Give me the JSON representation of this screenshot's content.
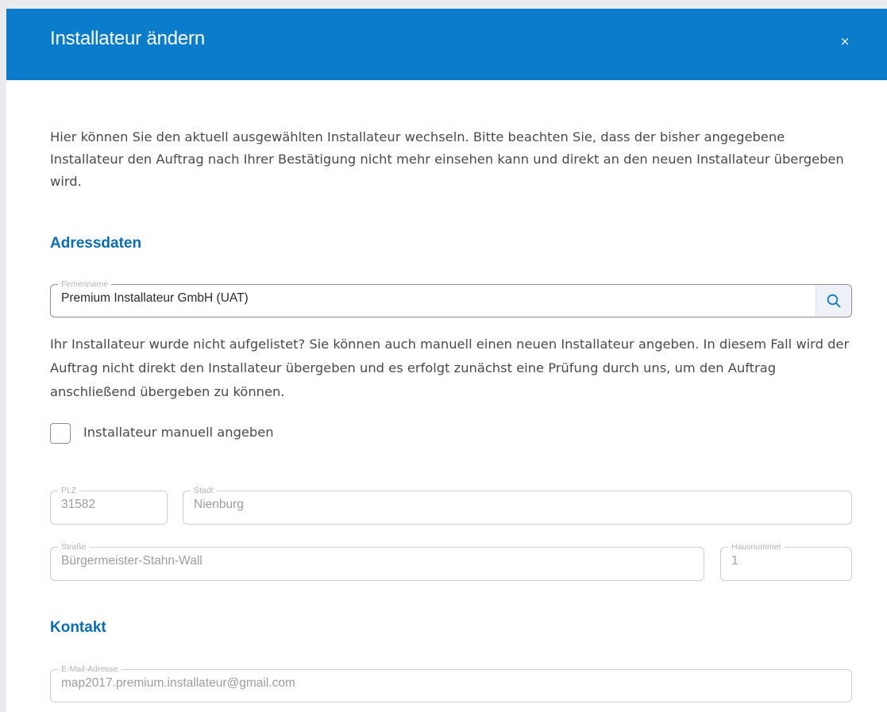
{
  "dialog": {
    "title": "Installateur ändern",
    "close_label": "×",
    "intro": "Hier können Sie den aktuell ausgewählten Installateur wechseln. Bitte beachten Sie, dass der bisher angegebene Installateur den Auftrag nach Ihrer Bestätigung nicht mehr einsehen kann und direkt an den neuen Installateur übergeben wird."
  },
  "address": {
    "heading": "Adressdaten",
    "company": {
      "label": "Firmenname",
      "value": "Premium Installateur GmbH (UAT)",
      "search_icon": "search-icon"
    },
    "note": "Ihr Installateur wurde nicht aufgelistet? Sie können auch manuell einen neuen Installateur angeben. In diesem Fall wird der Auftrag nicht direkt den Installateur übergeben und es erfolgt zunächst eine Prüfung durch uns, um den Auftrag anschließend übergeben zu können.",
    "manual_checkbox": {
      "label": "Installateur manuell angeben",
      "checked": false
    },
    "plz": {
      "label": "PLZ",
      "value": "31582"
    },
    "city": {
      "label": "Stadt",
      "value": "Nienburg"
    },
    "street": {
      "label": "Straße",
      "value": "Bürgermeister-Stahn-Wall"
    },
    "house_number": {
      "label": "Hausnummer",
      "value": "1"
    }
  },
  "contact": {
    "heading": "Kontakt",
    "email": {
      "label": "E-Mail-Adresse",
      "value": "map2017.premium.installateur@gmail.com"
    }
  },
  "colors": {
    "header_bg": "#0a7cc9",
    "section_heading": "#0a6cb2",
    "search_icon": "#0a7cc9"
  }
}
